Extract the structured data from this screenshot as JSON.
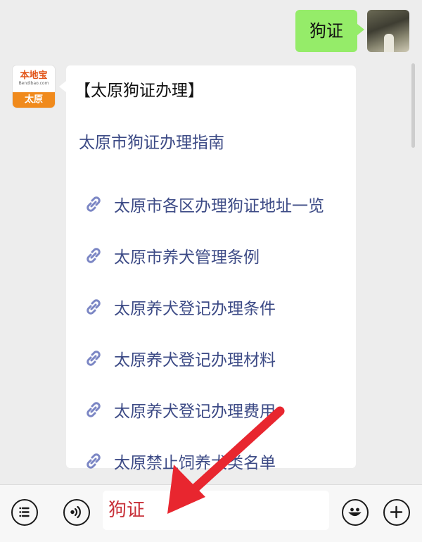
{
  "outgoing_message": {
    "text": "狗证"
  },
  "incoming_message": {
    "title": "【太原狗证办理】",
    "guide_link": "太原市狗证办理指南",
    "links": [
      {
        "label": "太原市各区办理狗证地址一览"
      },
      {
        "label": "太原市养犬管理条例"
      },
      {
        "label": "太原养犬登记办理条件"
      },
      {
        "label": "太原养犬登记办理材料"
      },
      {
        "label": "太原养犬登记办理费用"
      },
      {
        "label": "太原禁止饲养犬类名单"
      }
    ]
  },
  "bot_avatar": {
    "brand": "本地宝",
    "site": "Bendibao.com",
    "city": "太原"
  },
  "input_bar": {
    "input_value": "狗证"
  },
  "colors": {
    "outgoing_bubble": "#95ec69",
    "link_text": "#3d4b86",
    "input_text": "#c8313a",
    "annotation_arrow": "#e8262f"
  },
  "icons": [
    "link-icon",
    "menu-icon",
    "voice-icon",
    "emoji-icon",
    "plus-icon"
  ]
}
